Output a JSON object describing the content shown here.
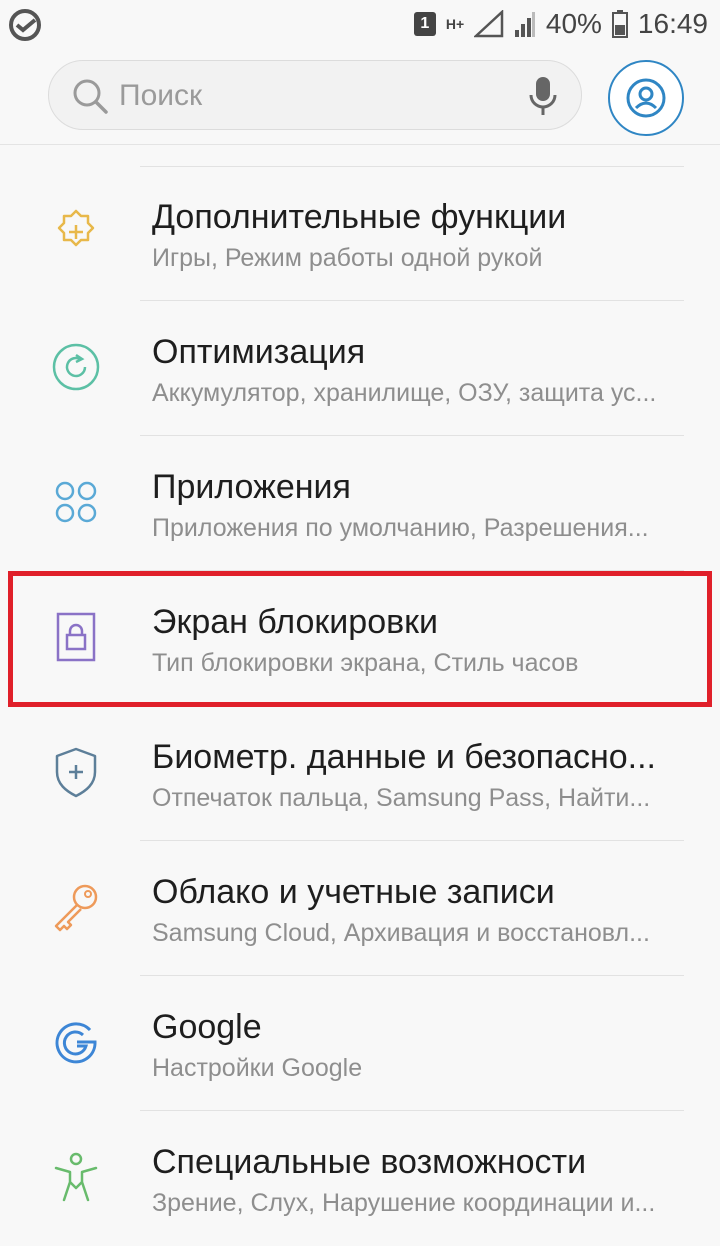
{
  "status_bar": {
    "sim_slot": "1",
    "network_type": "H+",
    "battery_percent": "40%",
    "time": "16:49"
  },
  "search": {
    "placeholder": "Поиск"
  },
  "settings": [
    {
      "title": "Дополнительные функции",
      "subtitle": "Игры, Режим работы одной рукой",
      "icon": "gear-plus-icon",
      "color": "#e8b84a"
    },
    {
      "title": "Оптимизация",
      "subtitle": "Аккумулятор, хранилище, ОЗУ, защита ус...",
      "icon": "refresh-circle-icon",
      "color": "#5cc0a5"
    },
    {
      "title": "Приложения",
      "subtitle": "Приложения по умолчанию, Разрешения...",
      "icon": "apps-grid-icon",
      "color": "#5aa9d6"
    },
    {
      "title": "Экран блокировки",
      "subtitle": "Тип блокировки экрана, Стиль часов",
      "icon": "lock-screen-icon",
      "color": "#8a72c6"
    },
    {
      "title": "Биометр. данные и безопасно...",
      "subtitle": "Отпечаток пальца, Samsung Pass, Найти...",
      "icon": "shield-plus-icon",
      "color": "#5d7f99"
    },
    {
      "title": "Облако и учетные записи",
      "subtitle": "Samsung Cloud, Архивация и восстановл...",
      "icon": "key-icon",
      "color": "#ee9a5a"
    },
    {
      "title": "Google",
      "subtitle": "Настройки Google",
      "icon": "google-icon",
      "color": "#3d86d6"
    },
    {
      "title": "Специальные возможности",
      "subtitle": "Зрение, Слух, Нарушение координации и...",
      "icon": "accessibility-icon",
      "color": "#68bb6c"
    }
  ],
  "highlighted_item": "Экран блокировки",
  "colors": {
    "highlight": "#e0202a",
    "account_ring": "#2f86c4",
    "background": "#f8f8f8"
  }
}
